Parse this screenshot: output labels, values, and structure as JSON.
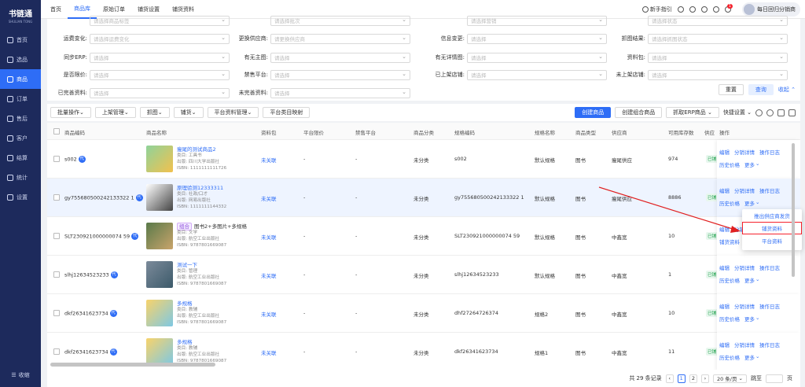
{
  "app": {
    "title": "书链通",
    "subtitle": "SHULIAN TONG"
  },
  "sidebar": {
    "items": [
      "首页",
      "选品",
      "商品",
      "订单",
      "售后",
      "客户",
      "结算",
      "统计",
      "设置"
    ],
    "bottom": "收缩"
  },
  "topbar": {
    "tabs": [
      "首页",
      "商品库",
      "原始订单",
      "铺货设置",
      "铺货资料"
    ],
    "guide": "新手指引",
    "notif_count": "1",
    "username": "每日回归分销商"
  },
  "filters": {
    "row0": [
      {
        "label": "",
        "ph": "请选择商品标签"
      },
      {
        "label": "",
        "ph": "请选择批次"
      },
      {
        "label": "",
        "ph": "请选择营销"
      },
      {
        "label": "",
        "ph": "请选择状态"
      }
    ],
    "row1": [
      {
        "label": "运费变化:",
        "ph": "请选择运费变化"
      },
      {
        "label": "更换供应商:",
        "ph": "请更换供应商"
      },
      {
        "label": "信息变更:",
        "ph": "请选择"
      },
      {
        "label": "抓图结果:",
        "ph": "请选择抓图状态"
      }
    ],
    "row2": [
      {
        "label": "同步ERP:",
        "ph": "请选择"
      },
      {
        "label": "有无主图:",
        "ph": "请选择"
      },
      {
        "label": "有无详情图:",
        "ph": "请选择"
      },
      {
        "label": "资料包:",
        "ph": "请选择"
      }
    ],
    "row3": [
      {
        "label": "是否限价:",
        "ph": "请选择"
      },
      {
        "label": "禁售平台:",
        "ph": "请选择"
      },
      {
        "label": "已上架店铺:",
        "ph": "请选择"
      },
      {
        "label": "未上架店铺:",
        "ph": "请选择"
      }
    ],
    "row4": [
      {
        "label": "已完善资料:",
        "ph": "请选择"
      },
      {
        "label": "未完善资料:",
        "ph": "请选择"
      }
    ],
    "reset": "重置",
    "search": "查询",
    "collapse": "收起"
  },
  "toolbar": {
    "left": [
      "批量操作",
      "上架管理",
      "抓图",
      "铺货",
      "平台资料管理",
      "平台类目映射"
    ],
    "right": [
      "创建商品",
      "创建组合商品",
      "抓取ERP商品",
      "快捷设置"
    ]
  },
  "table": {
    "headers": [
      "商品编码",
      "商品名称",
      "资料包",
      "平台限价",
      "禁售平台",
      "商品分类",
      "规格编码",
      "规格名称",
      "商品类型",
      "供应商",
      "可用库存数",
      "供应",
      "操作"
    ],
    "rows": [
      {
        "code": "s002",
        "name": "瘦尾的测试商品2",
        "cat": "类目: 工具书",
        "pub": "出版: 四川大学出版社",
        "isbn": "ISBN: 1111111111726",
        "pack": "未关联",
        "limit": "-",
        "ban": "-",
        "class": "未分类",
        "sku": "s002",
        "spec": "默认规格",
        "type": "图书",
        "supplier": "瘦尾供应",
        "stock": "974",
        "ops1": [
          "编辑",
          "分销详情",
          "操作日志"
        ],
        "ops2": [
          "历史价格",
          "更多"
        ]
      },
      {
        "code": "gy755680500242133322 1",
        "name": "原理验测12333311",
        "cat": "类目: 社政/口才",
        "pub": "出版: 网易出版社",
        "isbn": "ISBN: 1111111144332",
        "pack": "未关联",
        "limit": "-",
        "ban": "-",
        "class": "未分类",
        "sku": "gy755680500242133322 1",
        "spec": "默认规格",
        "type": "图书",
        "supplier": "瘦尾供应",
        "stock": "8886",
        "ops1": [
          "编辑",
          "分销详情",
          "操作日志"
        ],
        "ops2": [
          "历史价格",
          "更多"
        ]
      },
      {
        "code": "SLT230921000000074 59",
        "name": "图书2+多图片+多规格",
        "group": "组合",
        "cat": "类目: 文学",
        "pub": "出版: 航空工业出版社",
        "isbn": "ISBN: 9787801669087",
        "pack": "未关联",
        "limit": "-",
        "ban": "-",
        "class": "未分类",
        "sku": "SLT230921000000074 59",
        "spec": "默认规格",
        "type": "图书",
        "supplier": "中鑫宽",
        "stock": "10",
        "ops1": [
          "编辑",
          "分销"
        ],
        "ops2": [
          "铺货资料"
        ]
      },
      {
        "code": "slhj12634523233",
        "name": "测试一下",
        "cat": "类目: 管理",
        "pub": "出版: 航空工业出版社",
        "isbn": "ISBN: 9787801669087",
        "pack": "未关联",
        "limit": "-",
        "ban": "-",
        "class": "未分类",
        "sku": "slhj12634523233",
        "spec": "默认规格",
        "type": "图书",
        "supplier": "中鑫宽",
        "stock": "1",
        "ops1": [
          "编辑",
          "分销详情",
          "操作日志"
        ],
        "ops2": [
          "历史价格",
          "更多"
        ]
      },
      {
        "code": "dkf26341623734",
        "name": "多规格",
        "cat": "类目: 教辅",
        "pub": "出版: 航空工业出版社",
        "isbn": "ISBN: 9787801669087",
        "pack": "未关联",
        "limit": "-",
        "ban": "-",
        "class": "未分类",
        "sku": "dhf27264726374",
        "spec": "规格2",
        "type": "图书",
        "supplier": "中鑫宽",
        "stock": "10",
        "ops1": [
          "编辑",
          "分销详情",
          "操作日志"
        ],
        "ops2": [
          "历史价格",
          "更多"
        ]
      },
      {
        "code": "dkf26341623734",
        "name": "多规格",
        "cat": "类目: 教辅",
        "pub": "出版: 航空工业出版社",
        "isbn": "ISBN: 9787801669087",
        "pack": "未关联",
        "limit": "-",
        "ban": "-",
        "class": "未分类",
        "sku": "dkf26341623734",
        "spec": "规格1",
        "type": "图书",
        "supplier": "中鑫宽",
        "stock": "11",
        "ops1": [
          "编辑",
          "分销详情",
          "操作日志"
        ],
        "ops2": [
          "历史价格",
          "更多"
        ]
      }
    ],
    "tag": "已铺"
  },
  "dropdown": [
    "推出供应商发货",
    "铺货资料",
    "平台资料"
  ],
  "pager": {
    "total": "共 29 条记录",
    "pages": [
      "1",
      "2"
    ],
    "size": "20 条/页",
    "goto": "跳至",
    "page_unit": "页"
  },
  "colors": {
    "primary": "#2e6df6",
    "sidebar": "#1d2a5c",
    "arrow": "#e02020"
  }
}
